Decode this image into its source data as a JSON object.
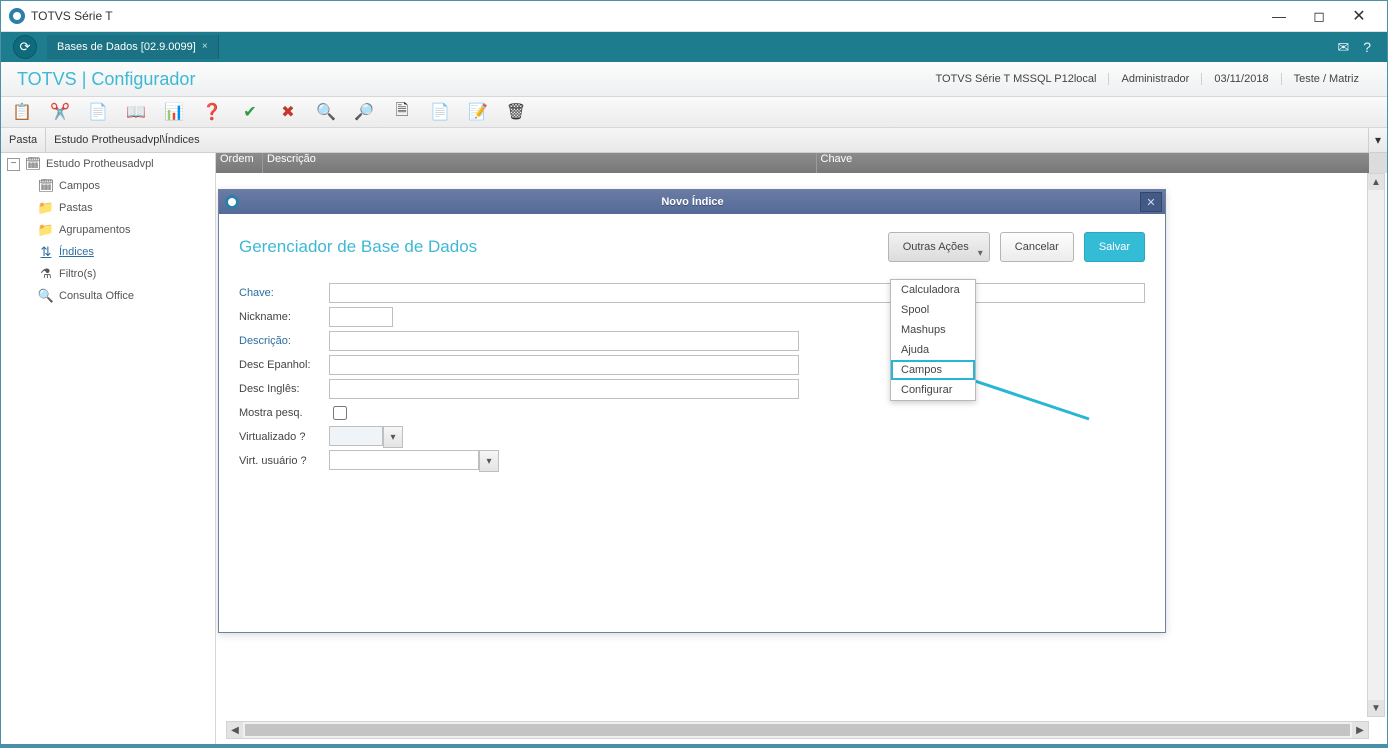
{
  "window": {
    "title": "TOTVS Série T"
  },
  "tab": {
    "label": "Bases de Dados [02.9.0099]"
  },
  "moduleHeader": {
    "brand_left": "TOTVS",
    "brand_sep": " | ",
    "brand_right": "Configurador",
    "env": "TOTVS Série T  MSSQL P12local",
    "user": "Administrador",
    "date": "03/11/2018",
    "branch": "Teste / Matriz"
  },
  "pasta": {
    "label": "Pasta",
    "path": "Estudo Protheusadvpl\\Índices"
  },
  "tree": {
    "root": "Estudo Protheusadvpl",
    "items": [
      "Campos",
      "Pastas",
      "Agrupamentos",
      "Índices",
      "Filtro(s)",
      "Consulta Office"
    ],
    "selectedIndex": 3
  },
  "grid": {
    "cols": [
      "Ordem",
      "Descrição",
      "Chave"
    ]
  },
  "dialog": {
    "title": "Novo Índice",
    "subtitle": "Gerenciador de Base de Dados",
    "btn_actions": "Outras Ações",
    "btn_cancel": "Cancelar",
    "btn_save": "Salvar",
    "labels": {
      "chave": "Chave:",
      "nickname": "Nickname:",
      "descricao": "Descrição:",
      "desc_es": "Desc Epanhol:",
      "desc_en": "Desc Inglês:",
      "mostra": "Mostra pesq.",
      "virt": "Virtualizado ?",
      "virt_user": "Virt. usuário ?"
    },
    "menu": [
      "Calculadora",
      "Spool",
      "Mashups",
      "Ajuda",
      "Campos",
      "Configurar"
    ],
    "menu_highlight_index": 4
  }
}
